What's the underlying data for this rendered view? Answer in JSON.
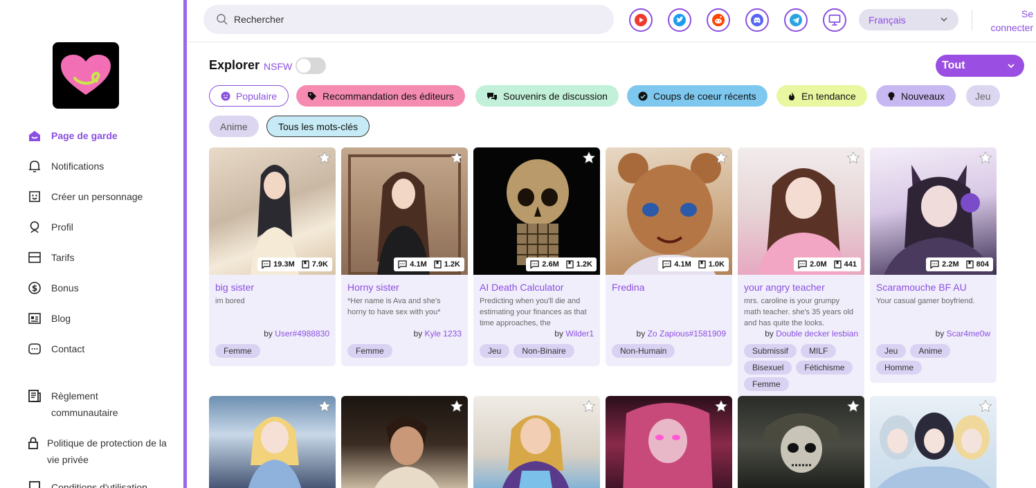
{
  "sidebar": {
    "nav": [
      {
        "label": "Page de garde",
        "icon": "home-icon",
        "active": true
      },
      {
        "label": "Notifications",
        "icon": "bell-icon"
      },
      {
        "label": "Créer un personnage",
        "icon": "face-icon"
      },
      {
        "label": "Profil",
        "icon": "profile-icon"
      },
      {
        "label": "Tarifs",
        "icon": "wallet-icon"
      },
      {
        "label": "Bonus",
        "icon": "dollar-icon"
      },
      {
        "label": "Blog",
        "icon": "news-icon"
      },
      {
        "label": "Contact",
        "icon": "chat-icon"
      }
    ],
    "secondary": [
      {
        "line1": "Règlement",
        "line2": "communautaire",
        "icon": "book-icon"
      },
      {
        "line1": "Politique de protection de la",
        "line2": "vie privée",
        "icon": "lock-icon"
      },
      {
        "line1": "Conditions d'utilisation",
        "line2": "",
        "icon": "doc-icon"
      }
    ]
  },
  "topbar": {
    "search_placeholder": "Rechercher",
    "social": [
      "youtube-icon",
      "twitter-icon",
      "reddit-icon",
      "discord-icon",
      "telegram-icon",
      "desktop-icon"
    ],
    "language": "Français",
    "login_line1": "Se",
    "login_line2": "connecter"
  },
  "explore": {
    "title": "Explorer",
    "nsfw_label": "NSFW",
    "filter_label": "Tout"
  },
  "tags": [
    {
      "label": "Populaire",
      "icon": "smile-icon"
    },
    {
      "label": "Recommandation des éditeurs",
      "icon": "tag-icon"
    },
    {
      "label": "Souvenirs de discussion",
      "icon": "chat-bubbles-icon"
    },
    {
      "label": "Coups de coeur récents",
      "icon": "heart-badge-icon"
    },
    {
      "label": "En tendance",
      "icon": "flame-icon"
    },
    {
      "label": "Nouveaux",
      "icon": "bulb-icon"
    },
    {
      "label": "Jeu",
      "icon": ""
    },
    {
      "label": "Anime",
      "icon": ""
    },
    {
      "label": "Tous les mots-clés",
      "icon": ""
    }
  ],
  "colors": {
    "accent": "#8a4fe0",
    "tag_pink": "#f58bb0",
    "tag_green": "#c2f0d8",
    "tag_blue": "#7ec8ef",
    "tag_yellow": "#e8f7a0",
    "tag_lavender": "#c8b8f2",
    "tag_gray": "#dcd6f0"
  },
  "cards": [
    {
      "name": "big sister",
      "desc": "im bored",
      "by_prefix": "by",
      "author": "User#4988830",
      "messages": "19.3M",
      "saves": "7.9K",
      "tags": [
        "Femme"
      ]
    },
    {
      "name": "Horny sister",
      "desc": "*Her name is Ava and she's horny to have sex with you*",
      "by_prefix": "by",
      "author": "Kyle 1233",
      "messages": "4.1M",
      "saves": "1.2K",
      "tags": [
        "Femme"
      ]
    },
    {
      "name": "AI Death Calculator",
      "desc": "Predicting when you'll die and estimating your finances as that time approaches, the",
      "by_prefix": "by",
      "author": "Wilder1",
      "messages": "2.6M",
      "saves": "1.2K",
      "tags": [
        "Jeu",
        "Non-Binaire"
      ]
    },
    {
      "name": "Fredina",
      "desc": "",
      "by_prefix": "by",
      "author": "Zo Zapious#1581909",
      "messages": "4.1M",
      "saves": "1.0K",
      "tags": [
        "Non-Humain"
      ]
    },
    {
      "name": "your angry teacher",
      "desc": "mrs. caroline is your grumpy math teacher. she's 35 years old and has quite the looks.",
      "by_prefix": "by",
      "author": "Double decker lesbian",
      "messages": "2.0M",
      "saves": "441",
      "tags": [
        "Submissif",
        "MILF",
        "Bisexuel",
        "Fétichisme",
        "Femme"
      ]
    },
    {
      "name": "Scaramouche BF AU",
      "desc": "Your casual gamer boyfriend.",
      "by_prefix": "by",
      "author": "Scar4me0w",
      "messages": "2.2M",
      "saves": "804",
      "tags": [
        "Jeu",
        "Anime",
        "Homme"
      ]
    }
  ]
}
